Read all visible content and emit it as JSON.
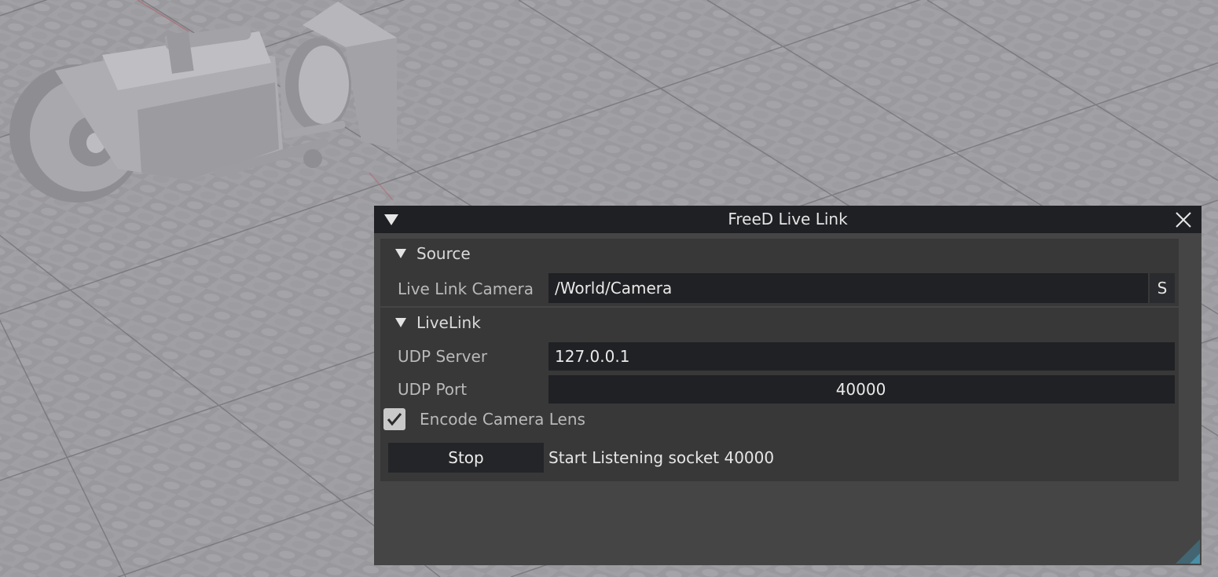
{
  "window": {
    "title": "FreeD Live Link"
  },
  "source": {
    "header": "Source",
    "camera_label": "Live Link Camera",
    "camera_value": "/World/Camera",
    "select_button": "S"
  },
  "livelink": {
    "header": "LiveLink",
    "udp_server_label": "UDP Server",
    "udp_server_value": "127.0.0.1",
    "udp_port_label": "UDP Port",
    "udp_port_value": "40000",
    "encode_lens_label": "Encode Camera Lens",
    "encode_lens_checked": true,
    "stop_button": "Stop",
    "status": "Start Listening socket 40000"
  },
  "icons": {
    "title_collapse": "triangle-down-icon",
    "close": "close-icon",
    "section_collapse": "triangle-down-icon",
    "checkbox": "checkmark-icon",
    "resize": "resize-grip-icon"
  },
  "colors": {
    "titlebar": "#1f2023",
    "panel": "#454545",
    "section": "#383838",
    "field": "#202124",
    "accent_grip": "#4a8fa8"
  }
}
